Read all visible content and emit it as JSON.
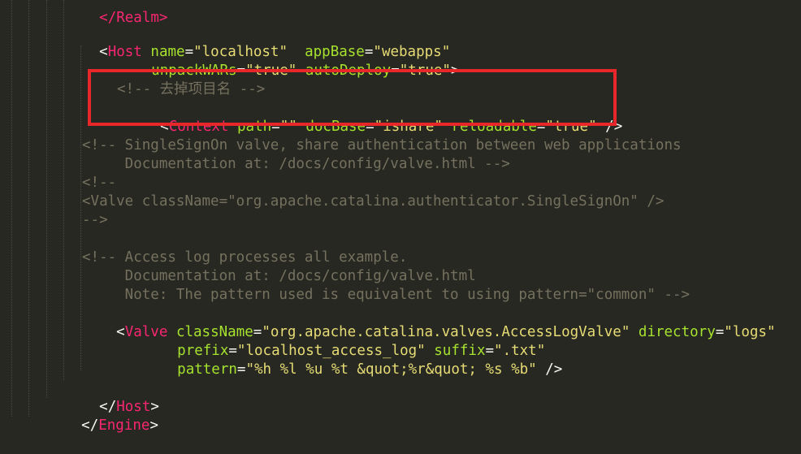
{
  "colors": {
    "background": "#272822",
    "tag": "#f92672",
    "attribute": "#a6e22e",
    "string": "#e6db74",
    "comment": "#75715e",
    "punctuation": "#f8f8f2",
    "highlight_box": "#e8272b"
  },
  "code": {
    "top_fragment": "</Realm>",
    "host_open": {
      "tag": "Host",
      "attr_name": "name",
      "val_name": "\"localhost\"",
      "attr_appbase": "appBase",
      "val_appbase": "\"webapps\"",
      "attr_unpack": "unpackWARs",
      "val_unpack": "\"true\"",
      "attr_autodeploy": "autoDeploy",
      "val_autodeploy": "\"true\""
    },
    "highlight": {
      "comment": "<!-- 去掉项目名 -->",
      "tag": "Context",
      "attr_path": "path",
      "val_path": "\"\"",
      "attr_docbase": "docBase",
      "val_docbase": "\"ishare\"",
      "attr_reloadable": "reloadable",
      "val_reloadable": "\"true\""
    },
    "sso_comment": [
      "<!-- SingleSignOn valve, share authentication between web applications",
      "     Documentation at: /docs/config/valve.html -->",
      "<!--",
      "<Valve className=\"org.apache.catalina.authenticator.SingleSignOn\" />",
      "-->"
    ],
    "access_comment": [
      "<!-- Access log processes all example.",
      "     Documentation at: /docs/config/valve.html",
      "     Note: The pattern used is equivalent to using pattern=\"common\" -->"
    ],
    "valve": {
      "tag": "Valve",
      "attr_classname": "className",
      "val_classname": "\"org.apache.catalina.valves.AccessLogValve\"",
      "attr_directory": "directory",
      "val_directory": "\"logs\"",
      "attr_prefix": "prefix",
      "val_prefix": "\"localhost_access_log\"",
      "attr_suffix": "suffix",
      "val_suffix": "\".txt\"",
      "attr_pattern": "pattern",
      "val_pattern": "\"%h %l %u %t &quot;%r&quot; %s %b\""
    },
    "host_close_tag": "Host",
    "engine_close_tag": "Engine"
  }
}
